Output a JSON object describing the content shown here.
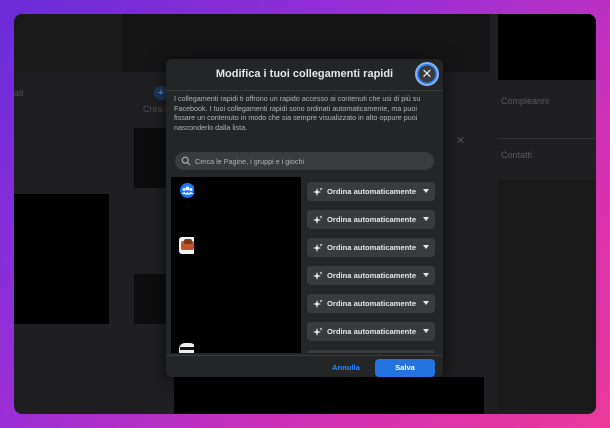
{
  "background_page": {
    "left_label_partial": "ati",
    "create_label_partial": "Crea s",
    "birthdays_label": "Compleanni",
    "contacts_label": "Contatti"
  },
  "modal": {
    "title": "Modifica i tuoi collegamenti rapidi",
    "close_icon": "close-icon",
    "description": "I collegamenti rapidi ti offrono un rapido accesso ai contenuti che usi di più su Facebook. I tuoi collegamenti rapidi sono ordinati automaticamente, ma puoi fissare un contenuto in modo che sia sempre visualizzato in alto oppure puoi nasconderlo dalla lista.",
    "search_placeholder": "Cerca le Pagine, i gruppi e i giochi",
    "shortcuts": [
      {
        "sort_label": "Ordina automaticamente"
      },
      {
        "sort_label": "Ordina automaticamente"
      },
      {
        "sort_label": "Ordina automaticamente"
      },
      {
        "sort_label": "Ordina automaticamente"
      },
      {
        "sort_label": "Ordina automaticamente"
      },
      {
        "sort_label": "Ordina automaticamente"
      },
      {
        "sort_label": "Ordina automaticamente"
      }
    ],
    "cancel_label": "Annulla",
    "save_label": "Salva"
  },
  "colors": {
    "accent": "#2374e1",
    "link": "#2d88ff",
    "modal_bg": "#242526",
    "button_bg": "#3a3b3c"
  }
}
